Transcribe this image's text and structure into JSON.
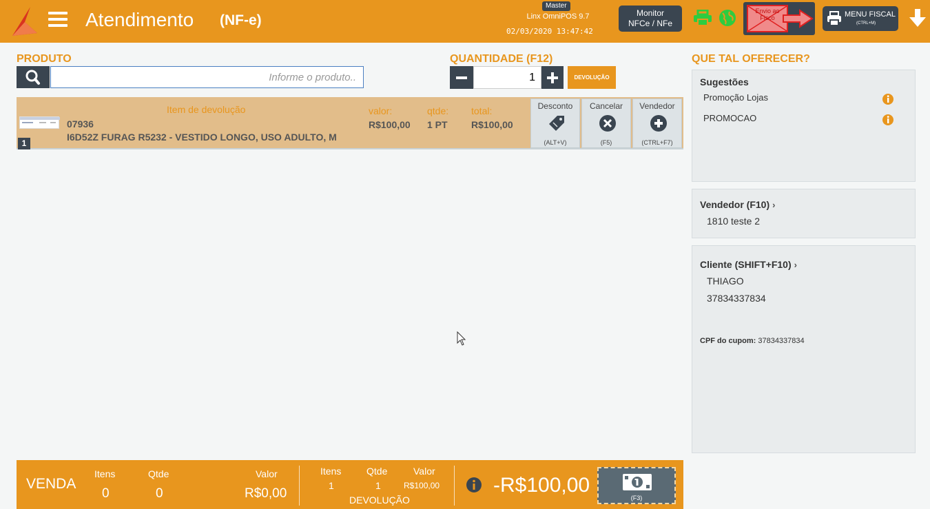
{
  "header": {
    "title": "Atendimento",
    "subtitle": "(NF-e)",
    "master_badge": "Master",
    "version": "Linx OmniPOS  9.7",
    "datetime": "02/03/2020 13:47:42",
    "monitor_line1": "Monitor",
    "monitor_line2": "NFCe / NFe",
    "envio_text": "Envio ao Fisco",
    "menu_fiscal_label": "MENU FISCAL",
    "menu_fiscal_shortcut": "(CTRL+M)"
  },
  "produto": {
    "label": "PRODUTO",
    "placeholder": "Informe o produto.."
  },
  "quantidade": {
    "label": "QUANTIDADE (F12)",
    "value": "1",
    "devolucao_label": "DEVOLUÇÃO"
  },
  "item": {
    "index": "1",
    "subtitle": "Item de devolução",
    "code": "07936",
    "description": "I6D52Z FURAG R5232 - VESTIDO LONGO, USO ADULTO, M",
    "valor_label": "valor:",
    "valor": "R$100,00",
    "qtde_label": "qtde:",
    "qtde": "1 PT",
    "total_label": "total:",
    "total": "R$100,00",
    "actions": [
      {
        "label": "Desconto",
        "key": "(ALT+V)"
      },
      {
        "label": "Cancelar",
        "key": "(F5)"
      },
      {
        "label": "Vendedor",
        "key": "(CTRL+F7)"
      }
    ]
  },
  "right": {
    "title": "QUE TAL OFERECER?",
    "sugestoes_title": "Sugestões",
    "sugestoes": [
      "Promoção Lojas",
      "PROMOCAO"
    ],
    "vendedor_title": "Vendedor (F10)",
    "vendedor_value": "1810 teste 2",
    "cliente_title": "Cliente (SHIFT+F10)",
    "cliente_name": "THIAGO",
    "cliente_doc": "37834337834",
    "cpf_label": "CPF do cupom:",
    "cpf_value": "37834337834"
  },
  "footer": {
    "venda_label": "VENDA",
    "itens_label": "Itens",
    "itens_value": "0",
    "qtde_label": "Qtde",
    "qtde_value": "0",
    "valor_label": "Valor",
    "valor_value": "R$0,00",
    "dev_itens_label": "Itens",
    "dev_itens_value": "1",
    "dev_qtde_label": "Qtde",
    "dev_qtde_value": "1",
    "dev_valor_label": "Valor",
    "dev_valor_value": "R$100,00",
    "devolucao_label": "DEVOLUÇÃO",
    "total": "-R$100,00",
    "pay_key": "(F3)"
  },
  "colors": {
    "accent": "#e8961e",
    "dark": "#3a4550",
    "green": "#2ecc40"
  }
}
